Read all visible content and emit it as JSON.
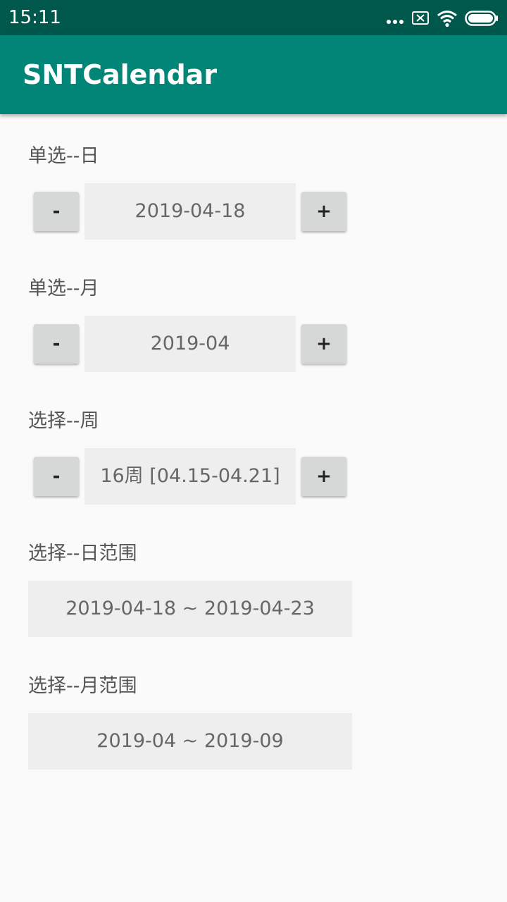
{
  "status_bar": {
    "time": "15:11",
    "icons": [
      "more-dots-icon",
      "sim-disabled-icon",
      "wifi-icon",
      "battery-icon"
    ]
  },
  "app_bar": {
    "title": "SNTCalendar"
  },
  "colors": {
    "status_bar": "#00574b",
    "app_bar": "#008577",
    "background": "#fafafa",
    "value_box": "#eeeeee",
    "button": "#d6d7d7"
  },
  "sections": {
    "day": {
      "label": "单选--日",
      "value": "2019-04-18",
      "minus_label": "-",
      "plus_label": "+"
    },
    "month": {
      "label": "单选--月",
      "value": "2019-04",
      "minus_label": "-",
      "plus_label": "+"
    },
    "week": {
      "label": "选择--周",
      "value": "16周 [04.15-04.21]",
      "minus_label": "-",
      "plus_label": "+"
    },
    "day_range": {
      "label": "选择--日范围",
      "value": "2019-04-18 ~ 2019-04-23"
    },
    "month_range": {
      "label": "选择--月范围",
      "value": "2019-04 ~ 2019-09"
    }
  }
}
